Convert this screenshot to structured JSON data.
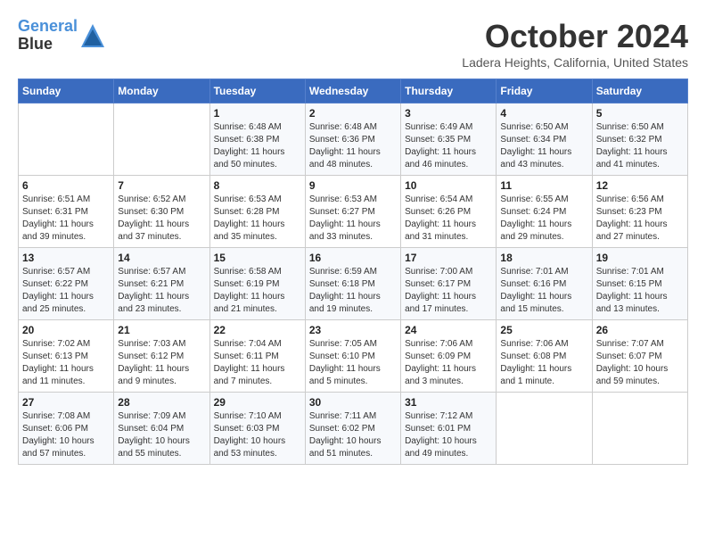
{
  "header": {
    "logo_line1": "General",
    "logo_line2": "Blue",
    "month": "October 2024",
    "location": "Ladera Heights, California, United States"
  },
  "weekdays": [
    "Sunday",
    "Monday",
    "Tuesday",
    "Wednesday",
    "Thursday",
    "Friday",
    "Saturday"
  ],
  "weeks": [
    [
      {
        "day": "",
        "info": ""
      },
      {
        "day": "",
        "info": ""
      },
      {
        "day": "1",
        "info": "Sunrise: 6:48 AM\nSunset: 6:38 PM\nDaylight: 11 hours and 50 minutes."
      },
      {
        "day": "2",
        "info": "Sunrise: 6:48 AM\nSunset: 6:36 PM\nDaylight: 11 hours and 48 minutes."
      },
      {
        "day": "3",
        "info": "Sunrise: 6:49 AM\nSunset: 6:35 PM\nDaylight: 11 hours and 46 minutes."
      },
      {
        "day": "4",
        "info": "Sunrise: 6:50 AM\nSunset: 6:34 PM\nDaylight: 11 hours and 43 minutes."
      },
      {
        "day": "5",
        "info": "Sunrise: 6:50 AM\nSunset: 6:32 PM\nDaylight: 11 hours and 41 minutes."
      }
    ],
    [
      {
        "day": "6",
        "info": "Sunrise: 6:51 AM\nSunset: 6:31 PM\nDaylight: 11 hours and 39 minutes."
      },
      {
        "day": "7",
        "info": "Sunrise: 6:52 AM\nSunset: 6:30 PM\nDaylight: 11 hours and 37 minutes."
      },
      {
        "day": "8",
        "info": "Sunrise: 6:53 AM\nSunset: 6:28 PM\nDaylight: 11 hours and 35 minutes."
      },
      {
        "day": "9",
        "info": "Sunrise: 6:53 AM\nSunset: 6:27 PM\nDaylight: 11 hours and 33 minutes."
      },
      {
        "day": "10",
        "info": "Sunrise: 6:54 AM\nSunset: 6:26 PM\nDaylight: 11 hours and 31 minutes."
      },
      {
        "day": "11",
        "info": "Sunrise: 6:55 AM\nSunset: 6:24 PM\nDaylight: 11 hours and 29 minutes."
      },
      {
        "day": "12",
        "info": "Sunrise: 6:56 AM\nSunset: 6:23 PM\nDaylight: 11 hours and 27 minutes."
      }
    ],
    [
      {
        "day": "13",
        "info": "Sunrise: 6:57 AM\nSunset: 6:22 PM\nDaylight: 11 hours and 25 minutes."
      },
      {
        "day": "14",
        "info": "Sunrise: 6:57 AM\nSunset: 6:21 PM\nDaylight: 11 hours and 23 minutes."
      },
      {
        "day": "15",
        "info": "Sunrise: 6:58 AM\nSunset: 6:19 PM\nDaylight: 11 hours and 21 minutes."
      },
      {
        "day": "16",
        "info": "Sunrise: 6:59 AM\nSunset: 6:18 PM\nDaylight: 11 hours and 19 minutes."
      },
      {
        "day": "17",
        "info": "Sunrise: 7:00 AM\nSunset: 6:17 PM\nDaylight: 11 hours and 17 minutes."
      },
      {
        "day": "18",
        "info": "Sunrise: 7:01 AM\nSunset: 6:16 PM\nDaylight: 11 hours and 15 minutes."
      },
      {
        "day": "19",
        "info": "Sunrise: 7:01 AM\nSunset: 6:15 PM\nDaylight: 11 hours and 13 minutes."
      }
    ],
    [
      {
        "day": "20",
        "info": "Sunrise: 7:02 AM\nSunset: 6:13 PM\nDaylight: 11 hours and 11 minutes."
      },
      {
        "day": "21",
        "info": "Sunrise: 7:03 AM\nSunset: 6:12 PM\nDaylight: 11 hours and 9 minutes."
      },
      {
        "day": "22",
        "info": "Sunrise: 7:04 AM\nSunset: 6:11 PM\nDaylight: 11 hours and 7 minutes."
      },
      {
        "day": "23",
        "info": "Sunrise: 7:05 AM\nSunset: 6:10 PM\nDaylight: 11 hours and 5 minutes."
      },
      {
        "day": "24",
        "info": "Sunrise: 7:06 AM\nSunset: 6:09 PM\nDaylight: 11 hours and 3 minutes."
      },
      {
        "day": "25",
        "info": "Sunrise: 7:06 AM\nSunset: 6:08 PM\nDaylight: 11 hours and 1 minute."
      },
      {
        "day": "26",
        "info": "Sunrise: 7:07 AM\nSunset: 6:07 PM\nDaylight: 10 hours and 59 minutes."
      }
    ],
    [
      {
        "day": "27",
        "info": "Sunrise: 7:08 AM\nSunset: 6:06 PM\nDaylight: 10 hours and 57 minutes."
      },
      {
        "day": "28",
        "info": "Sunrise: 7:09 AM\nSunset: 6:04 PM\nDaylight: 10 hours and 55 minutes."
      },
      {
        "day": "29",
        "info": "Sunrise: 7:10 AM\nSunset: 6:03 PM\nDaylight: 10 hours and 53 minutes."
      },
      {
        "day": "30",
        "info": "Sunrise: 7:11 AM\nSunset: 6:02 PM\nDaylight: 10 hours and 51 minutes."
      },
      {
        "day": "31",
        "info": "Sunrise: 7:12 AM\nSunset: 6:01 PM\nDaylight: 10 hours and 49 minutes."
      },
      {
        "day": "",
        "info": ""
      },
      {
        "day": "",
        "info": ""
      }
    ]
  ]
}
